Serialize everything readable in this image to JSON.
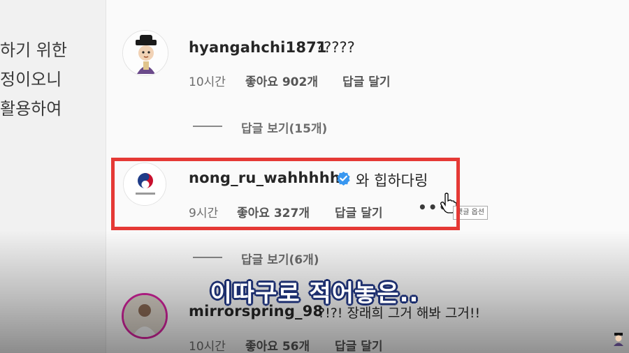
{
  "left_panel": {
    "lines": [
      "하기  위한",
      "정이오니",
      "활용하여"
    ]
  },
  "comments": [
    {
      "username": "hyangahchi1871",
      "text": "?????",
      "time": "10시간",
      "likes": "좋아요 902개",
      "reply": "답글 달기",
      "view_replies": "답글 보기(15개)"
    },
    {
      "username": "nong_ru_wahhhhh",
      "text": "와 힙하다링",
      "time": "9시간",
      "likes": "좋아요 327개",
      "reply": "답글 달기",
      "view_replies": "답글 보기(6개)",
      "verified": true,
      "tooltip": "댓글 옵션"
    },
    {
      "username": "mirrorspring_98",
      "text": "?!?! 장래희 그거 해봐 그거!!",
      "time": "10시간",
      "likes": "좋아요 56개",
      "reply": "답글 달기"
    }
  ],
  "subtitle": "이따구로 적어놓은..",
  "colors": {
    "highlight": "#e53935",
    "verified": "#3897f0",
    "subtitle_outline": "#1d2f6e"
  },
  "icons": [
    "verified-badge-icon",
    "more-options-icon",
    "hand-cursor-icon",
    "government-logo-icon",
    "character-icon"
  ]
}
